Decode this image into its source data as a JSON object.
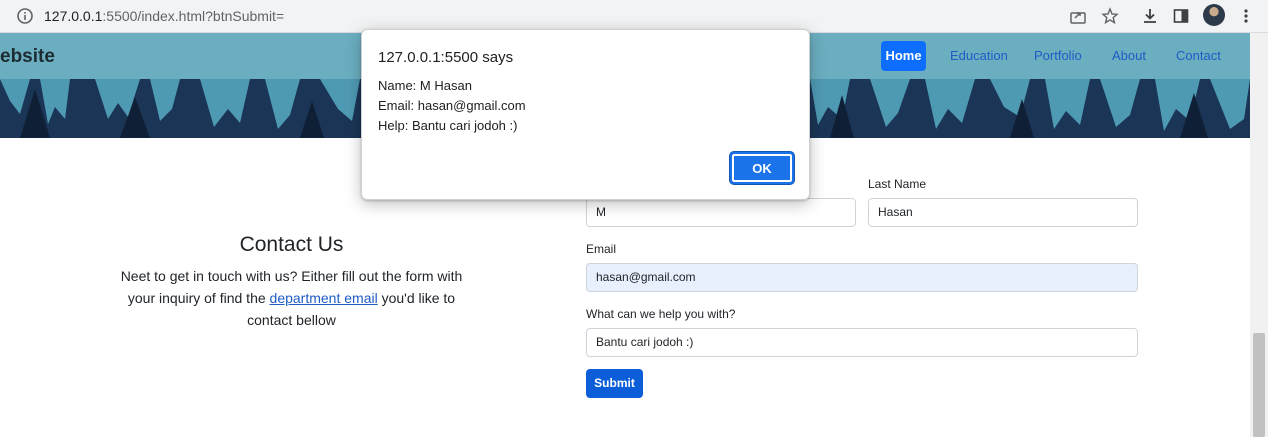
{
  "browser": {
    "url_host": "127.0.0.1",
    "url_rest": ":5500/index.html?btnSubmit=",
    "icons": [
      "info-icon",
      "share-icon",
      "star-icon",
      "download-icon",
      "sidepanel-icon",
      "profile-avatar",
      "more-vert-icon"
    ]
  },
  "navbar": {
    "brand": "ebsite",
    "links": [
      "Home",
      "Education",
      "Portfolio",
      "About",
      "Contact"
    ]
  },
  "contact": {
    "title": "Contact Us",
    "text_before": "Neet to get in touch with us? Either fill out the form with your inquiry of find the ",
    "link": "department email",
    "text_after": " you'd like to contact bellow"
  },
  "form": {
    "last_name_label": "Last Name",
    "first_name_value": "M",
    "last_name_value": "Hasan",
    "email_label": "Email",
    "email_value": "hasan@gmail.com",
    "help_label": "What can we help you with?",
    "help_value": "Bantu cari jodoh :)",
    "submit_label": "Submit"
  },
  "dialog": {
    "title": "127.0.0.1:5500 says",
    "line1": "Name: M Hasan",
    "line2": "Email: hasan@gmail.com",
    "line3": "Help: Bantu cari jodoh :)",
    "ok_label": "OK"
  },
  "colors": {
    "navbar": "#6aaec0",
    "accent": "#0d6efd",
    "hero": "#17304d"
  }
}
